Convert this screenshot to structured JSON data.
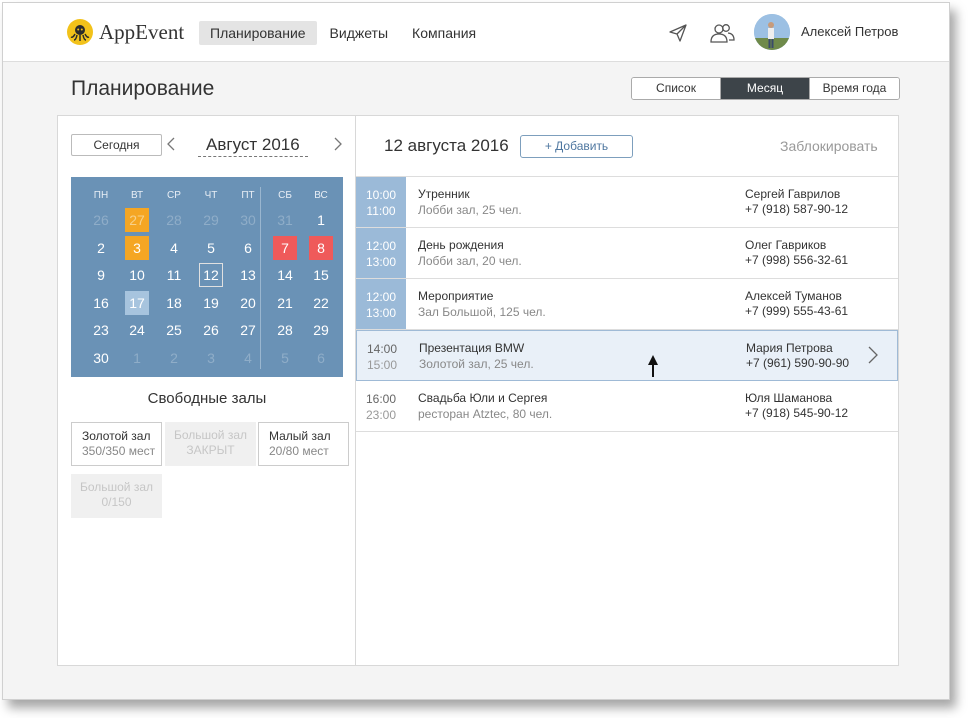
{
  "app": {
    "name": "AppEvent"
  },
  "nav": {
    "items": [
      {
        "label": "Планирование",
        "active": true
      },
      {
        "label": "Виджеты",
        "active": false
      },
      {
        "label": "Компания",
        "active": false
      }
    ],
    "icons": [
      "send-icon",
      "users-icon"
    ]
  },
  "user": {
    "name": "Алексей Петров"
  },
  "page": {
    "title": "Планирование"
  },
  "view_switch": {
    "options": [
      "Список",
      "Месяц",
      "Время года"
    ],
    "selected": "Месяц"
  },
  "calendar": {
    "today_label": "Сегодня",
    "month_label": "Август 2016",
    "weekdays": [
      "ПН",
      "ВТ",
      "СР",
      "ЧТ",
      "ПТ",
      "СБ",
      "ВС"
    ],
    "weeks": [
      [
        "26",
        "27",
        "28",
        "29",
        "30",
        "31",
        "1"
      ],
      [
        "2",
        "3",
        "4",
        "5",
        "6",
        "7",
        "8"
      ],
      [
        "9",
        "10",
        "11",
        "12",
        "13",
        "14",
        "15"
      ],
      [
        "16",
        "17",
        "18",
        "19",
        "20",
        "21",
        "22"
      ],
      [
        "23",
        "24",
        "25",
        "26",
        "27",
        "28",
        "29"
      ],
      [
        "30",
        "1",
        "2",
        "3",
        "4",
        "5",
        "6"
      ]
    ],
    "colors": {
      "background": "#6a92b6",
      "busy": "#f5a623",
      "holiday": "#ef5a5a",
      "selected": "#a7c4de"
    }
  },
  "free_halls": {
    "title": "Свободные залы",
    "halls": [
      {
        "name": "Золотой зал",
        "capacity": "350/350 мест",
        "closed": false
      },
      {
        "name": "Большой зал",
        "capacity": "ЗАКРЫТ",
        "closed": true
      },
      {
        "name": "Малый зал",
        "capacity": "20/80 мест",
        "closed": false
      },
      {
        "name": "Большой зал",
        "capacity": "0/150",
        "closed": true
      }
    ]
  },
  "day_view": {
    "date": "12 августа 2016",
    "add_label": "+ Добавить",
    "block_label": "Заблокировать",
    "events": [
      {
        "start": "10:00",
        "end": "11:00",
        "title": "Утренник",
        "place": "Лобби зал, 25 чел.",
        "person": "Сергей Гаврилов",
        "phone": "+7 (918) 587-90-12",
        "highlight": true,
        "selected": false
      },
      {
        "start": "12:00",
        "end": "13:00",
        "title": "День рождения",
        "place": "Лобби зал, 20 чел.",
        "person": "Олег Гавриков",
        "phone": "+7 (998) 556-32-61",
        "highlight": true,
        "selected": false
      },
      {
        "start": "12:00",
        "end": "13:00",
        "title": "Мероприятие",
        "place": "Зал Большой, 125 чел.",
        "person": "Алексей Туманов",
        "phone": "+7 (999) 555-43-61",
        "highlight": true,
        "selected": false
      },
      {
        "start": "14:00",
        "end": "15:00",
        "title": "Презентация BMW",
        "place": "Золотой зал, 25 чел.",
        "person": "Мария Петрова",
        "phone": "+7 (961) 590-90-90",
        "highlight": false,
        "selected": true
      },
      {
        "start": "16:00",
        "end": "23:00",
        "title": "Свадьба Юли и Сергея",
        "place": "ресторан Atztec, 80 чел.",
        "person": "Юля Шаманова",
        "phone": "+7 (918) 545-90-12",
        "highlight": false,
        "selected": false
      }
    ]
  }
}
